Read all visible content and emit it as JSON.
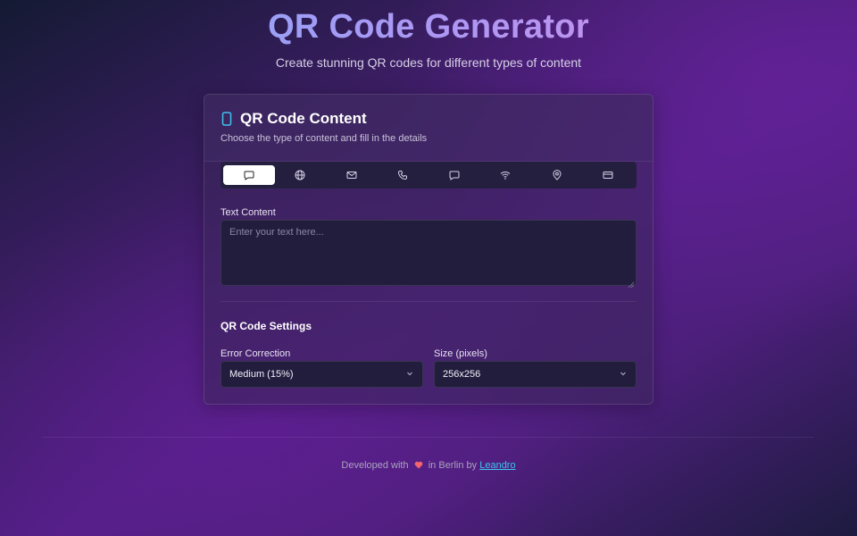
{
  "header": {
    "title": "QR Code Generator",
    "subtitle": "Create stunning QR codes for different types of content"
  },
  "card": {
    "title": "QR Code Content",
    "description": "Choose the type of content and fill in the details",
    "title_icon": "smartphone-icon"
  },
  "tabs": [
    {
      "icon": "message-square-icon",
      "active": true
    },
    {
      "icon": "globe-icon",
      "active": false
    },
    {
      "icon": "mail-icon",
      "active": false
    },
    {
      "icon": "phone-icon",
      "active": false
    },
    {
      "icon": "message-icon",
      "active": false
    },
    {
      "icon": "wifi-icon",
      "active": false
    },
    {
      "icon": "map-pin-icon",
      "active": false
    },
    {
      "icon": "credit-card-icon",
      "active": false
    }
  ],
  "text_field": {
    "label": "Text Content",
    "placeholder": "Enter your text here...",
    "value": ""
  },
  "settings": {
    "title": "QR Code Settings",
    "error_correction": {
      "label": "Error Correction",
      "value": "Medium (15%)"
    },
    "size": {
      "label": "Size (pixels)",
      "value": "256x256"
    }
  },
  "footer": {
    "prefix": "Developed with",
    "middle": "in Berlin by",
    "author": "Leandro",
    "heart_icon": "heart-icon"
  },
  "colors": {
    "accent_cyan": "#3fc3f0",
    "heart_red": "#f2646e",
    "title_gradient_start": "#7fb0f8",
    "title_gradient_end": "#d58ce9"
  }
}
